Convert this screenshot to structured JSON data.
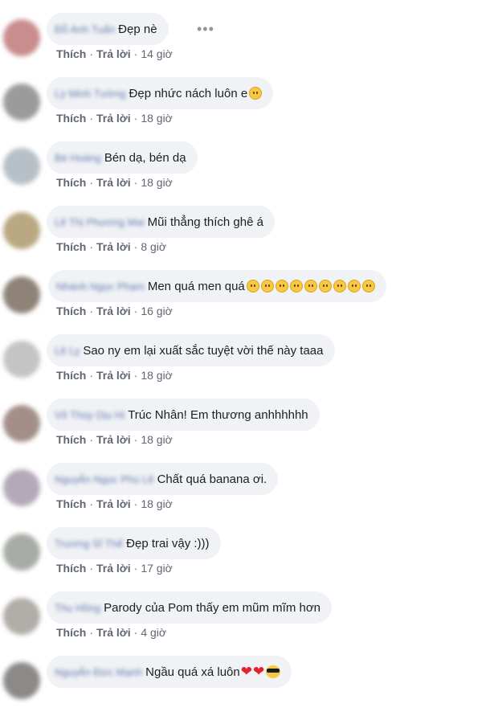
{
  "actions": {
    "like_label": "Thích",
    "reply_label": "Trả lời",
    "separator": "·"
  },
  "more_icon": "more-options-icon",
  "comments": [
    {
      "author": "Đỗ Anh Tuấn",
      "text": "Đẹp nè",
      "time": "14 giờ",
      "emojis": [],
      "avatar_color": "#c98d8d"
    },
    {
      "author": "Lý Minh Tường",
      "text": "Đẹp nhức nách luôn e",
      "time": "18 giờ",
      "emojis": [
        "rolling-laughing-emoji"
      ],
      "avatar_color": "#9b9b9b"
    },
    {
      "author": "Bé Hoàng",
      "text": "Bén dạ, bén dạ",
      "time": "18 giờ",
      "emojis": [],
      "avatar_color": "#b7c0c7"
    },
    {
      "author": "Lê Thị Phương Mai",
      "text": "Mũi thẳng thích ghê á",
      "time": "8 giờ",
      "emojis": [],
      "avatar_color": "#b9a882"
    },
    {
      "author": "Nhánh Ngọc Phạm",
      "text": "Men quá men quá",
      "time": "16 giờ",
      "emojis": [
        "pleading-emoji",
        "pleading-emoji",
        "pleading-emoji",
        "flushed-emoji",
        "flushed-emoji",
        "flushed-emoji",
        "screaming-emoji",
        "screaming-emoji",
        "screaming-emoji"
      ],
      "avatar_color": "#8f8378"
    },
    {
      "author": "Lê Ly",
      "text": "Sao ny em lại xuất sắc tuyệt vời thế này taaa",
      "time": "18 giờ",
      "emojis": [],
      "avatar_color": "#c4c4c4"
    },
    {
      "author": "Võ Thùy Dịu Hi",
      "text": "Trúc Nhân! Em thương anhhhhhh",
      "time": "18 giờ",
      "emojis": [],
      "avatar_color": "#a38f88"
    },
    {
      "author": "Nguyễn Ngọc Phú Lê",
      "text": "Chất quá banana ơi.",
      "time": "18 giờ",
      "emojis": [],
      "avatar_color": "#b4a9b8"
    },
    {
      "author": "Trương Sĩ Thế",
      "text": "Đẹp trai vậy :)))",
      "time": "17 giờ",
      "emojis": [],
      "avatar_color": "#a8aca6"
    },
    {
      "author": "Thu Hồng",
      "text": "Parody của Pom thấy em mũm mĩm hơn",
      "time": "4 giờ",
      "emojis": [],
      "avatar_color": "#b1ada8"
    },
    {
      "author": "Nguyễn Đức Mạnh",
      "text": "Ngầu quá xá luôn",
      "time": "",
      "emojis": [
        "heart-emoji",
        "heart-emoji",
        "sunglasses-emoji"
      ],
      "avatar_color": "#8c8a88"
    }
  ]
}
